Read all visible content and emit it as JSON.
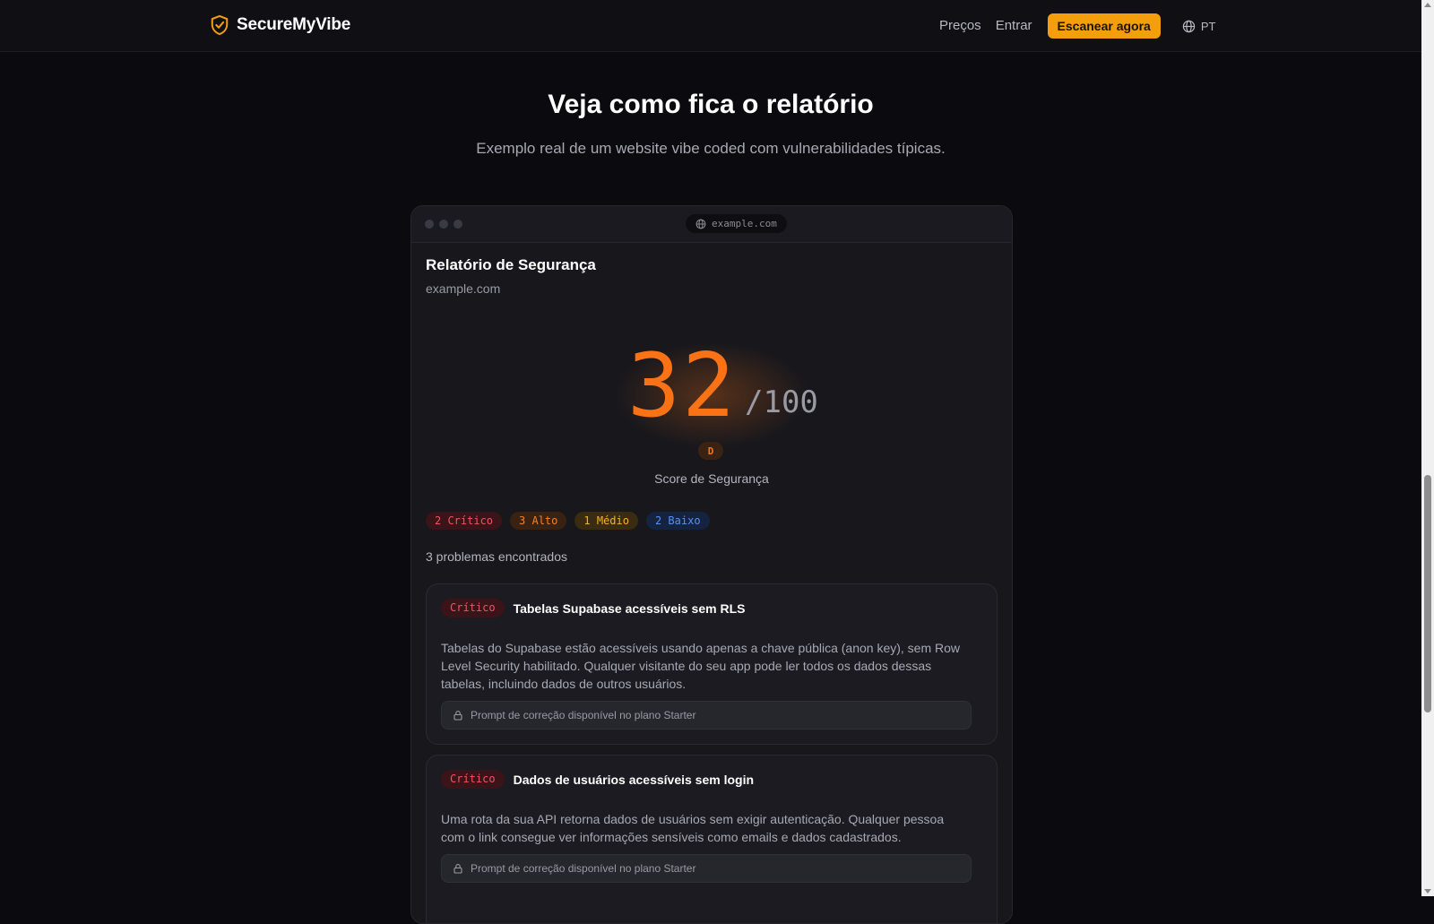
{
  "navbar": {
    "brand": "SecureMyVibe",
    "links": {
      "pricing": "Preços",
      "login": "Entrar"
    },
    "cta": "Escanear agora",
    "language": "PT"
  },
  "section": {
    "title": "Veja como fica o relatório",
    "subtitle": "Exemplo real de um website vibe coded com vulnerabilidades típicas."
  },
  "browser": {
    "url": "example.com"
  },
  "report": {
    "title": "Relatório de Segurança",
    "domain": "example.com",
    "score": "32",
    "score_max": "/100",
    "grade": "D",
    "score_label": "Score de Segurança",
    "badges": {
      "critical": "2 Crítico",
      "high": "3 Alto",
      "medium": "1 Médio",
      "low": "2 Baixo"
    },
    "problems_count": "3 problemas encontrados",
    "issues": [
      {
        "severity": "Crítico",
        "title": "Tabelas Supabase acessíveis sem RLS",
        "description": "Tabelas do Supabase estão acessíveis usando apenas a chave pública (anon key), sem Row Level Security habilitado. Qualquer visitante do seu app pode ler todos os dados dessas tabelas, incluindo dados de outros usuários.",
        "fix_prompt": "Prompt de correção disponível no plano Starter"
      },
      {
        "severity": "Crítico",
        "title": "Dados de usuários acessíveis sem login",
        "description": "Uma rota da sua API retorna dados de usuários sem exigir autenticação. Qualquer pessoa com o link consegue ver informações sensíveis como emails e dados cadastrados.",
        "fix_prompt": "Prompt de correção disponível no plano Starter"
      }
    ]
  },
  "colors": {
    "accent": "#f59e0b",
    "score": "#f97316",
    "critical": "#f25363",
    "high": "#f3822c",
    "medium": "#f3b22a",
    "low": "#5a90f3",
    "background": "#0b0b0f"
  },
  "icons": {
    "brand": "shield-check-icon",
    "language": "globe-icon",
    "url": "globe-icon",
    "fix": "lock-icon"
  }
}
